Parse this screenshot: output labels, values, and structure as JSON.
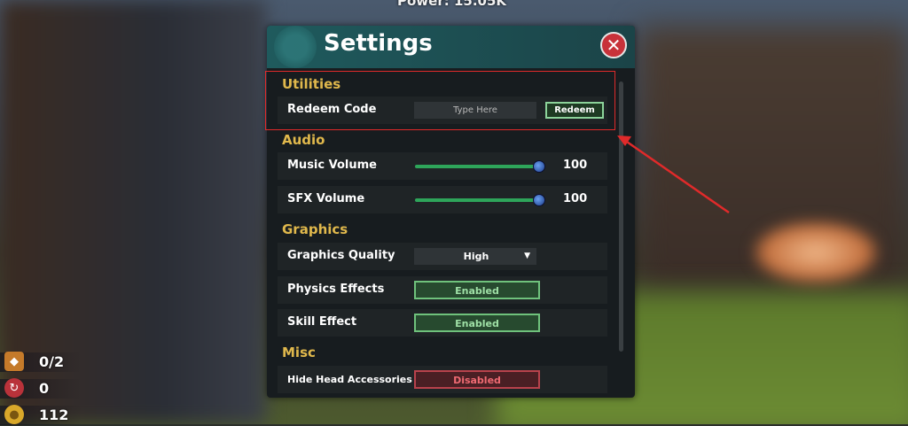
{
  "top_hud": {
    "power_text": "Power: 15.05K"
  },
  "hud": {
    "items": [
      {
        "icon": "chest-icon",
        "value": "0/2"
      },
      {
        "icon": "rebirth-icon",
        "value": "0"
      },
      {
        "icon": "coin-icon",
        "value": "112"
      }
    ]
  },
  "settings": {
    "title": "Settings",
    "sections": {
      "utilities": "Utilities",
      "audio": "Audio",
      "graphics": "Graphics",
      "misc": "Misc"
    },
    "redeem": {
      "label": "Redeem Code",
      "placeholder": "Type Here",
      "button": "Redeem"
    },
    "music": {
      "label": "Music Volume",
      "value": "100",
      "level": 1.0
    },
    "sfx": {
      "label": "SFX Volume",
      "value": "100",
      "level": 1.0
    },
    "graphics_quality": {
      "label": "Graphics Quality",
      "value": "High"
    },
    "physics": {
      "label": "Physics Effects",
      "value": "Enabled"
    },
    "skill": {
      "label": "Skill Effect",
      "value": "Enabled"
    },
    "head_acc": {
      "label": "Hide Head Accessories",
      "value": "Disabled"
    }
  },
  "colors": {
    "section_heading": "#e0b84c",
    "enabled": "#6fc27c",
    "disabled": "#b8424c",
    "slider": "#2ea55a",
    "close": "#c8323a",
    "annotation": "#e02a2a"
  }
}
